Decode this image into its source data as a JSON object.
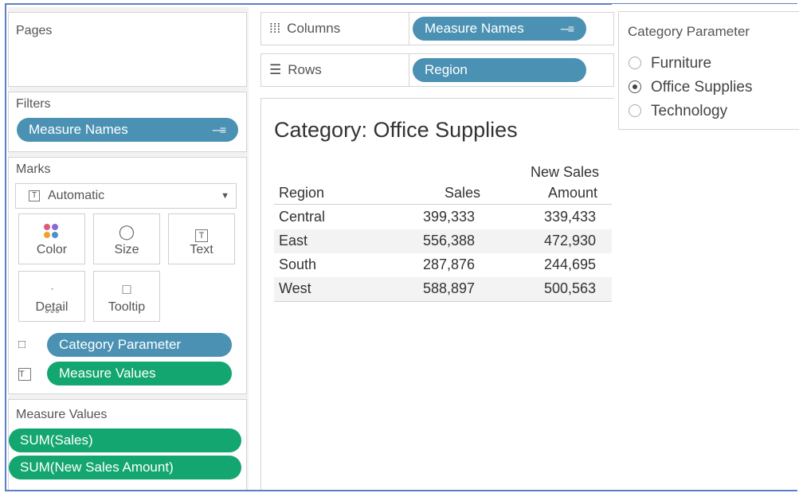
{
  "pages": {
    "title": "Pages"
  },
  "filters": {
    "title": "Filters",
    "pill": "Measure Names"
  },
  "marks": {
    "title": "Marks",
    "type": "Automatic",
    "buttons": {
      "color": "Color",
      "size": "Size",
      "text": "Text",
      "detail": "Detail",
      "tooltip": "Tooltip"
    },
    "fields": [
      {
        "label": "Category Parameter",
        "icon": "tooltip-icon"
      },
      {
        "label": "Measure Values",
        "icon": "text-icon"
      }
    ]
  },
  "measure_values": {
    "title": "Measure Values",
    "pills": [
      "SUM(Sales)",
      "SUM(New Sales Amount)"
    ]
  },
  "shelves": {
    "columns": {
      "label": "Columns",
      "pill": "Measure Names"
    },
    "rows": {
      "label": "Rows",
      "pill": "Region"
    }
  },
  "view": {
    "title": "Category: Office Supplies",
    "headers": {
      "region": "Region",
      "sales": "Sales",
      "new_sales_line1": "New Sales",
      "new_sales_line2": "Amount"
    },
    "rows": [
      {
        "region": "Central",
        "sales": "399,333",
        "new_sales": "339,433"
      },
      {
        "region": "East",
        "sales": "556,388",
        "new_sales": "472,930"
      },
      {
        "region": "South",
        "sales": "287,876",
        "new_sales": "244,695"
      },
      {
        "region": "West",
        "sales": "588,897",
        "new_sales": "500,563"
      }
    ]
  },
  "parameter": {
    "title": "Category Parameter",
    "options": [
      "Furniture",
      "Office Supplies",
      "Technology"
    ],
    "selected": "Office Supplies"
  },
  "colors": {
    "blue_pill": "#4a91b3",
    "green_pill": "#13a671",
    "frame": "#5a7fc8"
  }
}
